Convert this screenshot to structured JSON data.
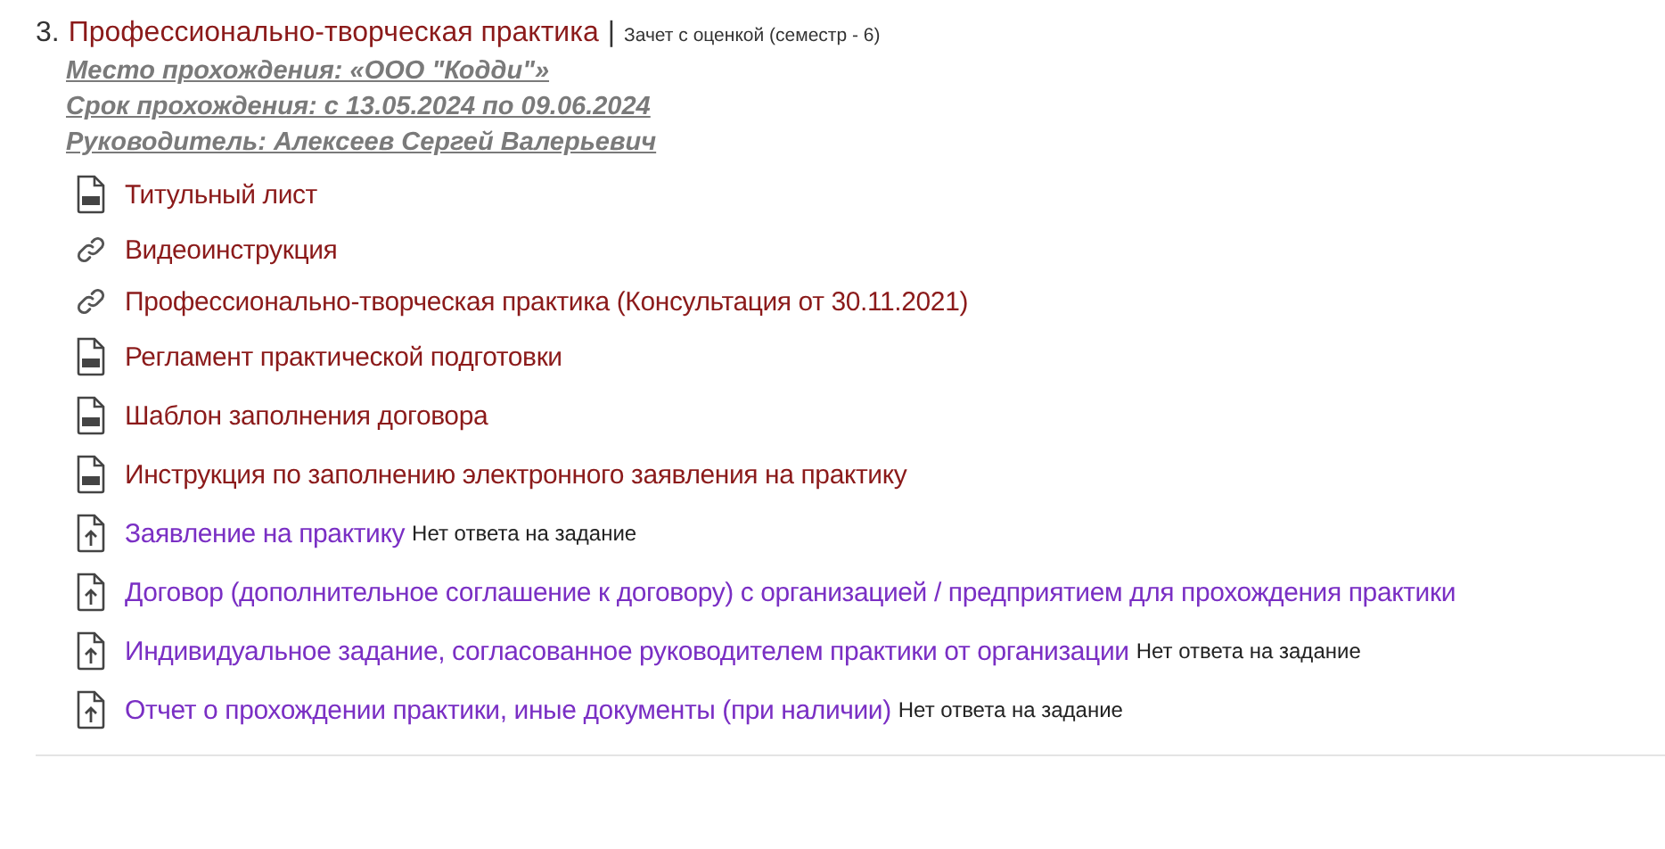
{
  "section": {
    "number": "3.",
    "title": "Профессионально-творческая практика",
    "separator": "|",
    "assessment": "Зачет с оценкой (семестр - 6)",
    "details": [
      "Место прохождения: «ООО \"Кодди\"»",
      "Срок прохождения: с 13.05.2024 по 09.06.2024",
      "Руководитель: Алексеев Сергей Валерьевич"
    ],
    "items": [
      {
        "kind": "pdf",
        "label": "Титульный лист"
      },
      {
        "kind": "link",
        "label": "Видеоинструкция"
      },
      {
        "kind": "link",
        "label": "Профессионально-творческая практика (Консультация от 30.11.2021)"
      },
      {
        "kind": "doc",
        "label": "Регламент практической подготовки"
      },
      {
        "kind": "pdf",
        "label": "Шаблон заполнения договора"
      },
      {
        "kind": "doc",
        "label": "Инструкция по заполнению электронного заявления на практику"
      },
      {
        "kind": "assignment",
        "label": "Заявление на практику",
        "status": "Нет ответа на задание"
      },
      {
        "kind": "assignment",
        "label": "Договор (дополнительное соглашение к договору) с организацией / предприятием для прохождения практики"
      },
      {
        "kind": "assignment",
        "label": "Индивидуальное задание, согласованное руководителем практики от организации",
        "status": "Нет ответа на задание"
      },
      {
        "kind": "assignment",
        "label": "Отчет о прохождении практики, иные документы (при наличии)",
        "status": "Нет ответа на задание"
      }
    ]
  }
}
